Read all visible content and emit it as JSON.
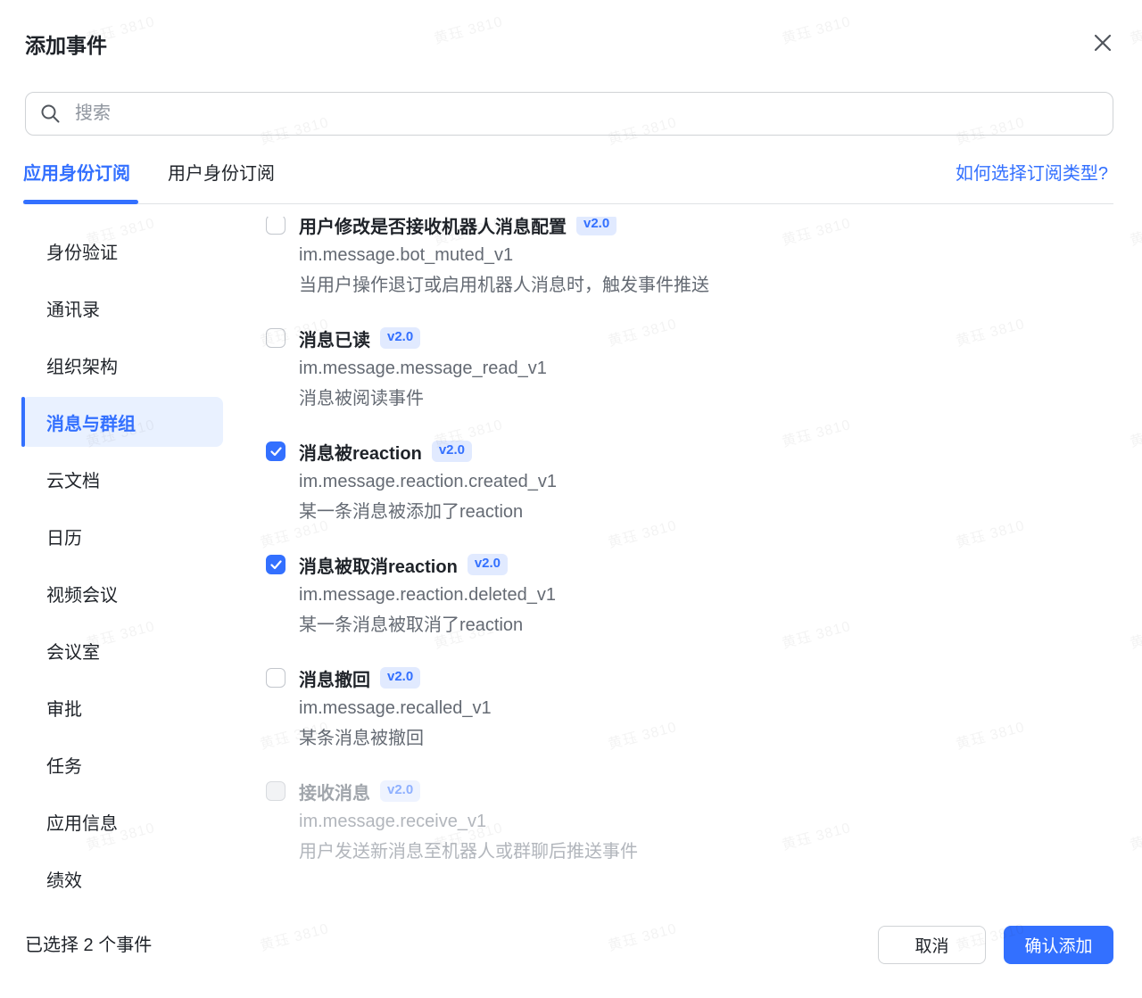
{
  "header": {
    "title": "添加事件"
  },
  "search": {
    "placeholder": "搜索"
  },
  "tabs": [
    {
      "label": "应用身份订阅",
      "active": true
    },
    {
      "label": "用户身份订阅",
      "active": false
    }
  ],
  "help_link": {
    "label": "如何选择订阅类型?"
  },
  "sidebar": {
    "items": [
      {
        "label": "身份验证",
        "selected": false
      },
      {
        "label": "通讯录",
        "selected": false
      },
      {
        "label": "组织架构",
        "selected": false
      },
      {
        "label": "消息与群组",
        "selected": true
      },
      {
        "label": "云文档",
        "selected": false
      },
      {
        "label": "日历",
        "selected": false
      },
      {
        "label": "视频会议",
        "selected": false
      },
      {
        "label": "会议室",
        "selected": false
      },
      {
        "label": "审批",
        "selected": false
      },
      {
        "label": "任务",
        "selected": false
      },
      {
        "label": "应用信息",
        "selected": false
      },
      {
        "label": "绩效",
        "selected": false
      }
    ]
  },
  "events": [
    {
      "title": "用户修改是否接收机器人消息配置",
      "badge": "v2.0",
      "api": "im.message.bot_muted_v1",
      "desc": "当用户操作退订或启用机器人消息时，触发事件推送",
      "checked": false,
      "disabled": false
    },
    {
      "title": "消息已读",
      "badge": "v2.0",
      "api": "im.message.message_read_v1",
      "desc": "消息被阅读事件",
      "checked": false,
      "disabled": false
    },
    {
      "title": "消息被reaction",
      "badge": "v2.0",
      "api": "im.message.reaction.created_v1",
      "desc": "某一条消息被添加了reaction",
      "checked": true,
      "disabled": false
    },
    {
      "title": "消息被取消reaction",
      "badge": "v2.0",
      "api": "im.message.reaction.deleted_v1",
      "desc": "某一条消息被取消了reaction",
      "checked": true,
      "disabled": false
    },
    {
      "title": "消息撤回",
      "badge": "v2.0",
      "api": "im.message.recalled_v1",
      "desc": "某条消息被撤回",
      "checked": false,
      "disabled": false
    },
    {
      "title": "接收消息",
      "badge": "v2.0",
      "api": "im.message.receive_v1",
      "desc": "用户发送新消息至机器人或群聊后推送事件",
      "checked": false,
      "disabled": true
    }
  ],
  "footer": {
    "selection_summary": "已选择 2 个事件",
    "cancel_label": "取消",
    "confirm_label": "确认添加"
  },
  "watermark": {
    "text": "黄珏 3810"
  },
  "colors": {
    "accent": "#3370ff",
    "badge_bg": "#e1eaff",
    "selected_bg": "#e9f1ff"
  }
}
